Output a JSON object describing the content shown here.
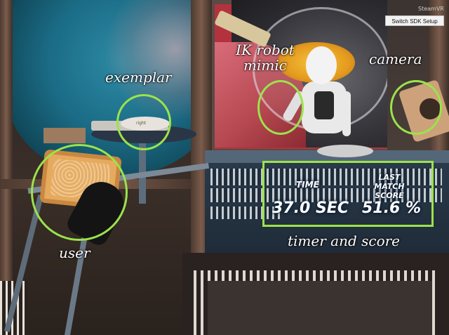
{
  "app": {
    "overlay_label": "SteamVR",
    "sdk_button_label": "Switch SDK Setup"
  },
  "scene": {
    "exemplar_plate_label": "right"
  },
  "annotations": {
    "exemplar": "exemplar",
    "ik_robot_mimic": "IK robot mimic",
    "camera": "camera",
    "user": "user",
    "timer_and_score": "timer and score",
    "highlight_color": "#9be34a"
  },
  "hud": {
    "time_label": "TIME",
    "score_label": "LAST MATCH SCORE",
    "time_value": "37.0 SEC",
    "score_value": "51.6 %"
  }
}
